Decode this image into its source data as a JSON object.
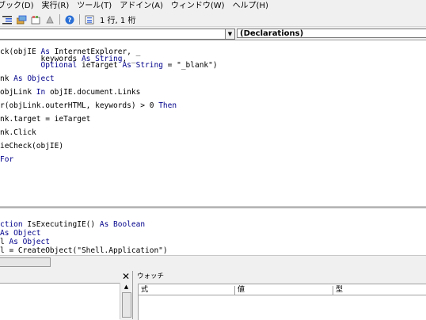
{
  "menu": {
    "items": [
      "ブック(D)",
      "実行(R)",
      "ツール(T)",
      "アドイン(A)",
      "ウィンドウ(W)",
      "ヘルプ(H)"
    ]
  },
  "toolbar": {
    "icons": [
      "indent-icon",
      "object-browser-icon",
      "properties-icon",
      "toolbox-icon",
      "help-icon",
      "line-col-icon"
    ],
    "position_text": "1 行, 1 桁"
  },
  "procedure_bar": {
    "object_value": "",
    "procedure_value": "(Declarations)"
  },
  "code_upper": {
    "lines": [
      {
        "kw": false,
        "segments": [
          {
            "t": "ck(objIE ",
            "k": false
          },
          {
            "t": "As",
            "k": true
          },
          {
            "t": " InternetExplorer, _",
            "k": false
          }
        ]
      },
      {
        "kw": false,
        "segments": [
          {
            "t": "         keywords ",
            "k": false
          },
          {
            "t": "As String",
            "k": true
          },
          {
            "t": ", _",
            "k": false
          }
        ]
      },
      {
        "kw": false,
        "segments": [
          {
            "t": "         ",
            "k": false
          },
          {
            "t": "Optional",
            "k": true
          },
          {
            "t": " ieTarget ",
            "k": false
          },
          {
            "t": "As String",
            "k": true
          },
          {
            "t": " = \"_blank\")",
            "k": false
          }
        ]
      },
      {
        "kw": false,
        "segments": [
          {
            "t": "",
            "k": false
          }
        ]
      },
      {
        "kw": false,
        "segments": [
          {
            "t": "nk ",
            "k": false
          },
          {
            "t": "As Object",
            "k": true
          }
        ]
      },
      {
        "kw": false,
        "segments": [
          {
            "t": "",
            "k": false
          }
        ]
      },
      {
        "kw": false,
        "segments": [
          {
            "t": "objLink ",
            "k": false
          },
          {
            "t": "In",
            "k": true
          },
          {
            "t": " objIE.document.Links",
            "k": false
          }
        ]
      },
      {
        "kw": false,
        "segments": [
          {
            "t": "",
            "k": false
          }
        ]
      },
      {
        "kw": false,
        "segments": [
          {
            "t": "r(objLink.outerHTML, keywords) > 0 ",
            "k": false
          },
          {
            "t": "Then",
            "k": true
          }
        ]
      },
      {
        "kw": false,
        "segments": [
          {
            "t": "",
            "k": false
          }
        ]
      },
      {
        "kw": false,
        "segments": [
          {
            "t": "nk.target = ieTarget",
            "k": false
          }
        ]
      },
      {
        "kw": false,
        "segments": [
          {
            "t": "",
            "k": false
          }
        ]
      },
      {
        "kw": false,
        "segments": [
          {
            "t": "nk.Click",
            "k": false
          }
        ]
      },
      {
        "kw": false,
        "segments": [
          {
            "t": "",
            "k": false
          }
        ]
      },
      {
        "kw": false,
        "segments": [
          {
            "t": "ieCheck(objIE)",
            "k": false
          }
        ]
      },
      {
        "kw": false,
        "segments": [
          {
            "t": "",
            "k": false
          }
        ]
      },
      {
        "kw": false,
        "segments": [
          {
            "t": "For",
            "k": true
          }
        ]
      }
    ]
  },
  "code_lower": {
    "lines": [
      {
        "segments": [
          {
            "t": "ction",
            "k": true
          },
          {
            "t": " IsExecutingIE() ",
            "k": false
          },
          {
            "t": "As Boolean",
            "k": true
          }
        ]
      },
      {
        "segments": [
          {
            "t": "As Object",
            "k": true
          }
        ]
      },
      {
        "segments": [
          {
            "t": "l ",
            "k": false
          },
          {
            "t": "As Object",
            "k": true
          }
        ]
      },
      {
        "segments": [
          {
            "t": "l = CreateObject(\"Shell.Application\")",
            "k": false
          }
        ]
      }
    ]
  },
  "immediate": {
    "close_glyph": "✕"
  },
  "watch": {
    "title": "ウォッチ",
    "columns": [
      "式",
      "値",
      "型"
    ]
  }
}
